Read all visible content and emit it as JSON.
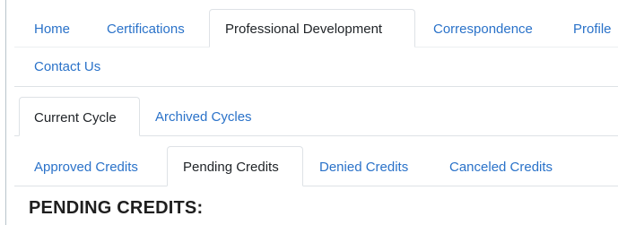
{
  "main_nav": {
    "tabs": [
      {
        "label": "Home",
        "active": false
      },
      {
        "label": "Certifications",
        "active": false
      },
      {
        "label": "Professional Development",
        "active": true
      },
      {
        "label": "Correspondence",
        "active": false
      },
      {
        "label": "Profile",
        "active": false
      },
      {
        "label": "Contact Us",
        "active": false
      }
    ]
  },
  "cycle_nav": {
    "tabs": [
      {
        "label": "Current Cycle",
        "active": true
      },
      {
        "label": "Archived Cycles",
        "active": false
      }
    ]
  },
  "credits_nav": {
    "tabs": [
      {
        "label": "Approved Credits",
        "active": false
      },
      {
        "label": "Pending Credits",
        "active": true
      },
      {
        "label": "Denied Credits",
        "active": false
      },
      {
        "label": "Canceled Credits",
        "active": false
      }
    ]
  },
  "section": {
    "heading": "PENDING CREDITS:"
  },
  "colors": {
    "link": "#2a72c9",
    "active_text": "#212529",
    "border": "#dee2e6"
  }
}
